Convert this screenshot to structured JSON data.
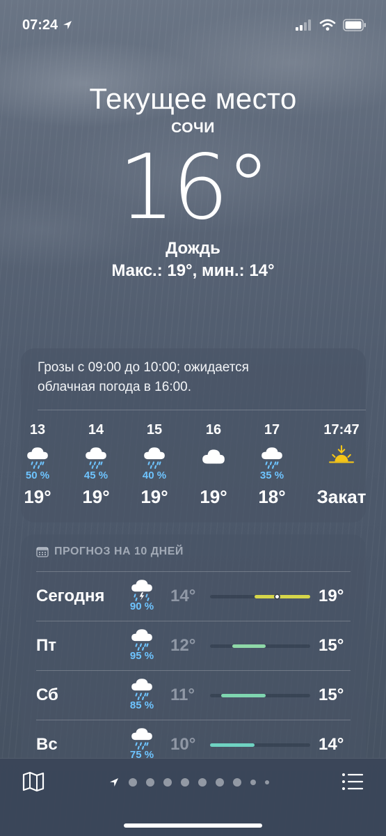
{
  "status": {
    "time": "07:24"
  },
  "header": {
    "place": "Текущее место",
    "city": "СОЧИ",
    "temperature": "16°",
    "condition": "Дождь",
    "minmax": "Макс.: 19°, мин.: 14°"
  },
  "hourly": {
    "summary_line1": "Грозы с 09:00 до 10:00; ожидается",
    "summary_line2": "облачная погода в 16:00.",
    "items": [
      {
        "hour": "13",
        "icon": "cloud-rain-icon",
        "precip": "50 %",
        "temp": "19°"
      },
      {
        "hour": "14",
        "icon": "cloud-rain-icon",
        "precip": "45 %",
        "temp": "19°"
      },
      {
        "hour": "15",
        "icon": "cloud-rain-icon",
        "precip": "40 %",
        "temp": "19°"
      },
      {
        "hour": "16",
        "icon": "cloud-icon",
        "precip": "",
        "temp": "19°"
      },
      {
        "hour": "17",
        "icon": "cloud-rain-icon",
        "precip": "35 %",
        "temp": "18°"
      },
      {
        "hour": "17:47",
        "icon": "sunset-icon",
        "precip": "",
        "temp": "Закат"
      }
    ]
  },
  "daily": {
    "header": "ПРОГНОЗ НА 10 ДНЕЙ",
    "scale": {
      "min": 10,
      "max": 19
    },
    "rows": [
      {
        "day": "Сегодня",
        "icon": "cloud-bolt-rain-icon",
        "precip": "90 %",
        "low": "14°",
        "high": "19°",
        "low_value": 14,
        "high_value": 19,
        "current_value": 16,
        "color": "#d6d64a"
      },
      {
        "day": "Пт",
        "icon": "cloud-rain-icon",
        "precip": "95 %",
        "low": "12°",
        "high": "15°",
        "low_value": 12,
        "high_value": 15,
        "color": "#8fd9a8"
      },
      {
        "day": "Сб",
        "icon": "cloud-rain-icon",
        "precip": "85 %",
        "low": "11°",
        "high": "15°",
        "low_value": 11,
        "high_value": 15,
        "color": "#7fd6b0"
      },
      {
        "day": "Вс",
        "icon": "cloud-rain-icon",
        "precip": "75 %",
        "low": "10°",
        "high": "14°",
        "low_value": 10,
        "high_value": 14,
        "color": "#6fd3c2"
      }
    ]
  },
  "tabbar": {
    "left_icon": "map-icon",
    "right_icon": "list-icon",
    "pages": 10,
    "current_page_icon": "location-arrow-icon"
  },
  "colors": {
    "precip": "#6ec4ff",
    "sun": "#f5c518"
  }
}
